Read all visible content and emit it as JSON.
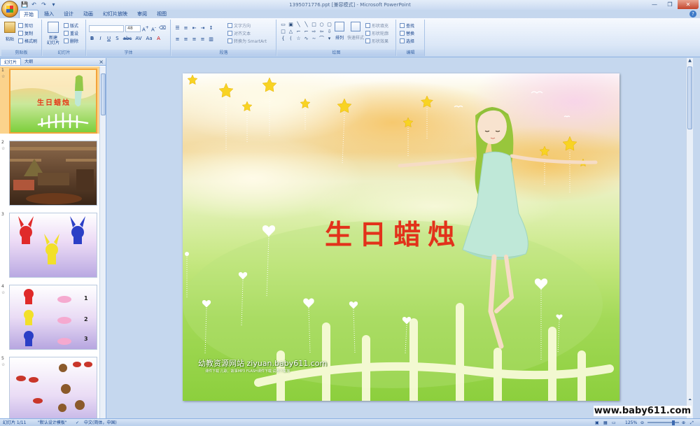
{
  "window": {
    "title": "1395071776.ppt [兼容模式] - Microsoft PowerPoint",
    "controls": [
      "—",
      "❐",
      "✕"
    ]
  },
  "quick_access": [
    "💾",
    "↶",
    "↷",
    "▾"
  ],
  "tabs": [
    "开始",
    "插入",
    "设计",
    "动画",
    "幻灯片放映",
    "审阅",
    "视图"
  ],
  "active_tab": "开始",
  "ribbon": {
    "clipboard": {
      "label": "剪贴板",
      "paste": "粘贴",
      "cut": "剪切",
      "copy": "复制",
      "format_painter": "格式刷"
    },
    "slides": {
      "label": "幻灯片",
      "new_slide": "新建\n幻灯片",
      "layout": "版式",
      "reset": "重设",
      "delete": "删除"
    },
    "font": {
      "label": "字体",
      "font_name": "",
      "font_size": "48",
      "format_buttons": [
        "B",
        "I",
        "U",
        "S",
        "abc",
        "AV",
        "Aa",
        "A"
      ]
    },
    "paragraph": {
      "label": "段落",
      "text_direction": "文字方向",
      "align_text": "对齐文本",
      "smartart": "转换为 SmartArt"
    },
    "drawing": {
      "label": "绘图",
      "arrange": "排列",
      "quick_styles": "快速样式",
      "shape_fill": "形状填充",
      "shape_outline": "形状轮廓",
      "shape_effects": "形状效果"
    },
    "editing": {
      "label": "编辑",
      "find": "查找",
      "replace": "替换",
      "select": "选择"
    }
  },
  "panel": {
    "tabs": [
      "幻灯片",
      "大纲"
    ],
    "close": "×",
    "slides": [
      {
        "num": "1",
        "title": "生日蜡烛"
      },
      {
        "num": "2"
      },
      {
        "num": "3"
      },
      {
        "num": "4",
        "numbers": [
          "1",
          "2",
          "3"
        ]
      },
      {
        "num": "5"
      }
    ]
  },
  "slide": {
    "title": "生日蜡烛",
    "site": "幼教资源网站  ziyuan.baby611.com",
    "site_sub": "课件下载  儿歌、故事MP3  FLASH课件下载  试卷下载等"
  },
  "watermark": "www.baby611.com",
  "status": {
    "slide_info": "幻灯片 1/11",
    "theme": "\"默认设计模板\"",
    "language": "中文(简体，中国)",
    "zoom": "125%"
  },
  "colors": {
    "accent": "#15428b",
    "title_red": "#e2321b",
    "selected": "#f3a33a"
  }
}
